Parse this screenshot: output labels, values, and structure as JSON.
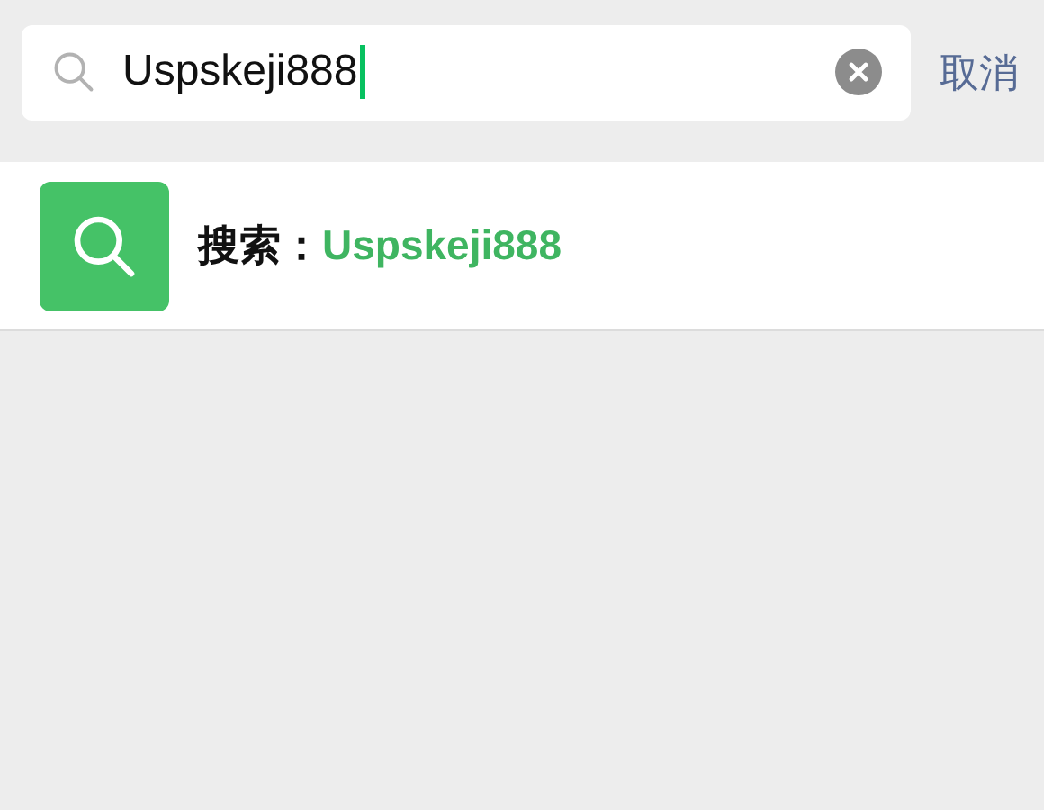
{
  "search_bar": {
    "value": "Uspskeji888",
    "cancel": "取消"
  },
  "suggestion": {
    "label": "搜索：",
    "query": "Uspskeji888"
  }
}
